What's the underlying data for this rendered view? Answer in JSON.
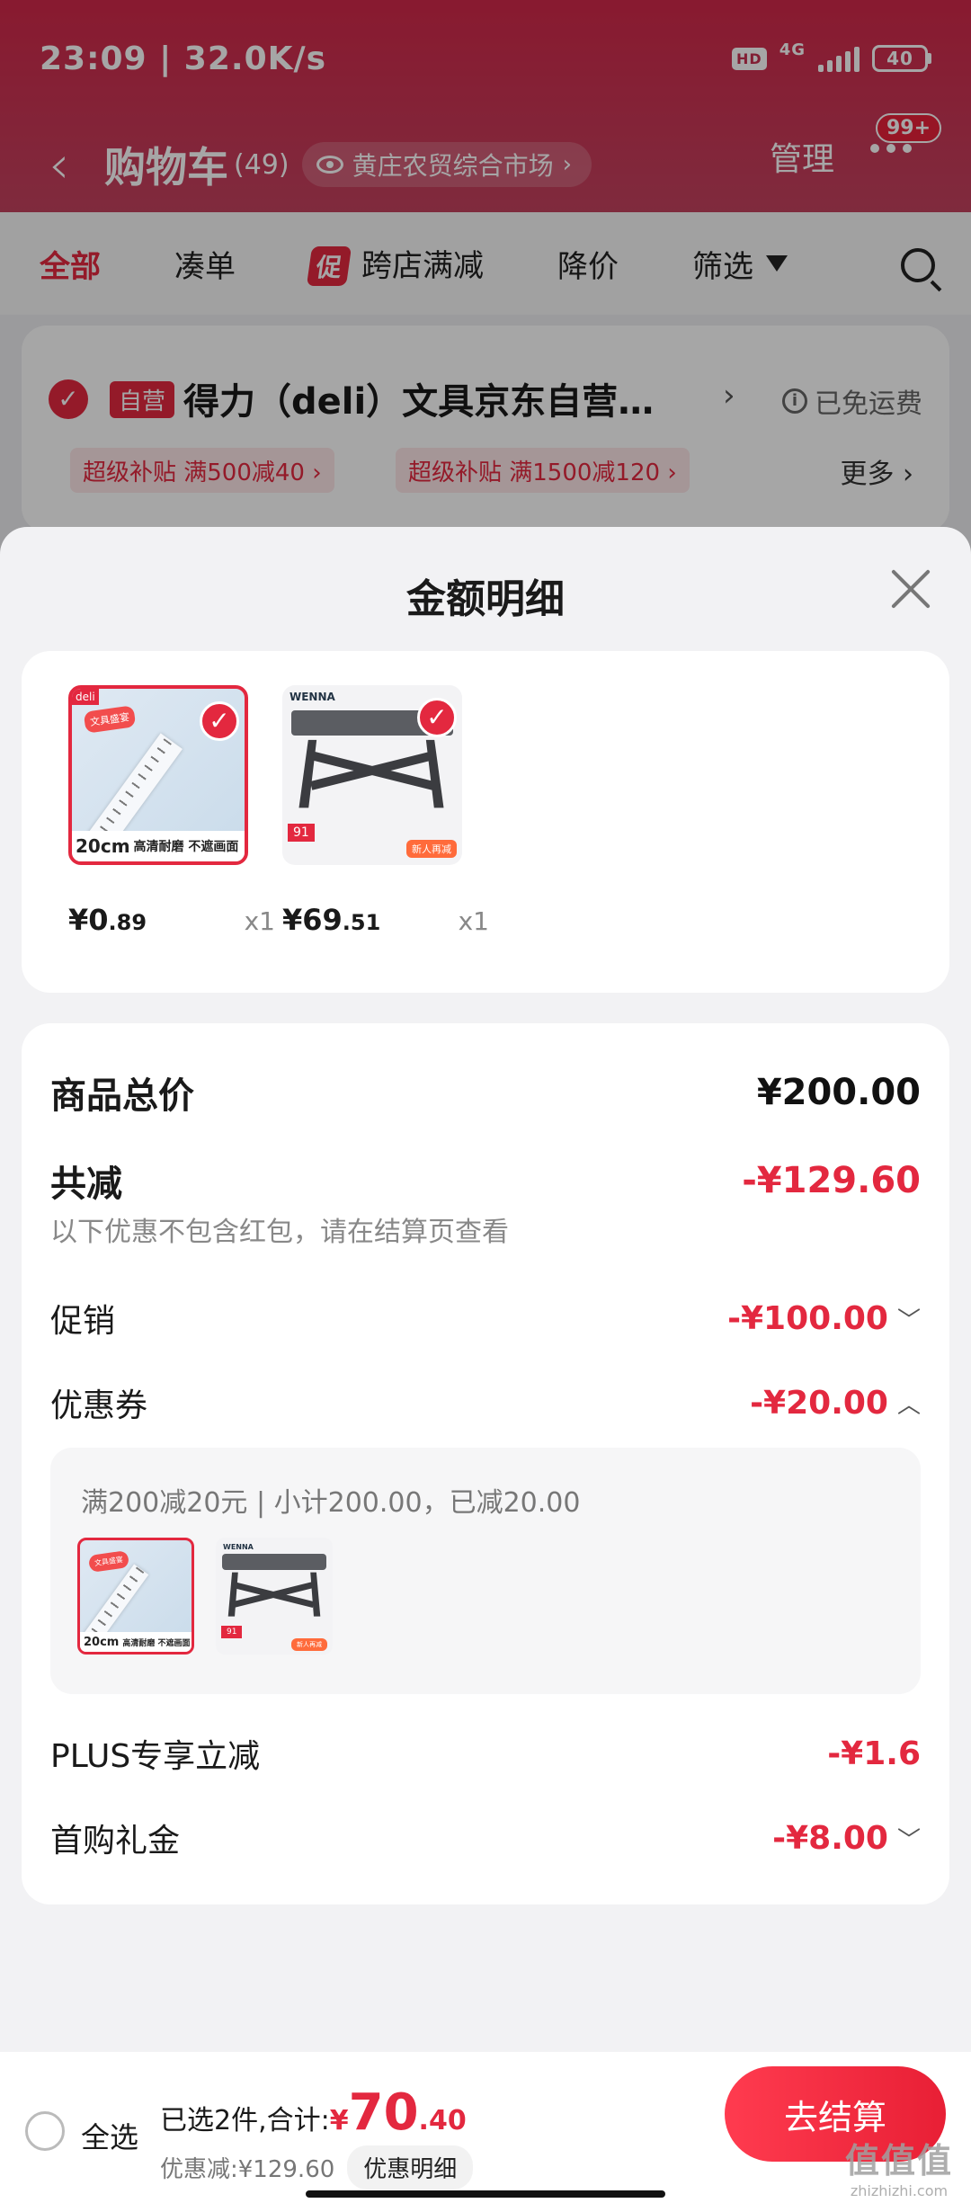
{
  "status_bar": {
    "time_speed": "23:09 | 32.0K/s",
    "hd": "HD",
    "network": "4G",
    "battery": "40"
  },
  "header": {
    "back_icon": "chevron-left-icon",
    "title": "购物车",
    "count": "(49)",
    "location": "黄庄农贸综合市场",
    "manage": "管理",
    "more_badge": "99+"
  },
  "filter_tabs": {
    "items": [
      "全部",
      "凑单",
      "跨店满减",
      "降价",
      "筛选"
    ],
    "promo_mark": "促",
    "active": "全部"
  },
  "store": {
    "self_tag": "自营",
    "name": "得力（deli）文具京东自营旗舰店",
    "shipping": "已免运费",
    "coupons": [
      "超级补贴  满500减40 ›",
      "超级补贴  满1500减120 ›"
    ],
    "more": "更多 ›"
  },
  "sheet": {
    "title": "金额明细",
    "products": [
      {
        "price_int": "¥0",
        "price_dec": ".89",
        "qty": "x1",
        "image_caption": "20cm",
        "image_caption_sub": "高清耐磨 不遮画面",
        "brand": "deli"
      },
      {
        "price_int": "¥69",
        "price_dec": ".51",
        "qty": "x1",
        "brand": "WENNA",
        "image_price": "91",
        "image_tag": "新人再减"
      }
    ],
    "rows": {
      "total_label": "商品总价",
      "total_value": "¥200.00",
      "reduce_label": "共减",
      "reduce_value": "-¥129.60",
      "note": "以下优惠不包含红包，请在结算页查看",
      "promo_label": "促销",
      "promo_value": "-¥100.00",
      "coupon_label": "优惠券",
      "coupon_value": "-¥20.00",
      "coupon_detail": "满200减20元 | 小计200.00，已减20.00",
      "plus_label": "PLUS专享立减",
      "plus_value": "-¥1.6",
      "gift_label": "首购礼金",
      "gift_value": "-¥8.00"
    }
  },
  "bottom_bar": {
    "select_all": "全选",
    "selected_prefix": "已选2件,合计:",
    "total_yen": "¥",
    "total_int": "70",
    "total_dec": ".40",
    "discount": "优惠减:¥129.60",
    "details_button": "优惠明细",
    "checkout": "去结算",
    "watermark": "值值值",
    "watermark_sub": "zhizhizhi.com"
  },
  "colors": {
    "accent": "#e3283f",
    "header_bg": "#d2284a"
  }
}
